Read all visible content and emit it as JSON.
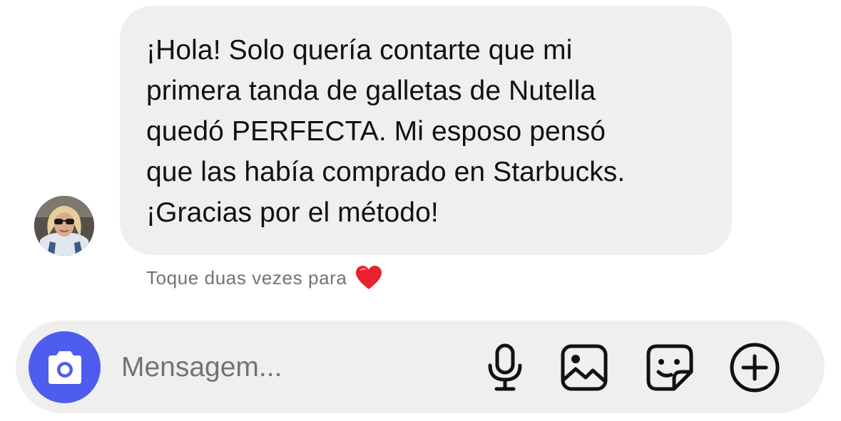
{
  "message": {
    "lines": [
      "¡Hola! Solo quería contarte que mi",
      "primera tanda de galletas de Nutella",
      "quedó PERFECTA. Mi esposo pensó",
      "que las había comprado en Starbucks.",
      "¡Gracias por el método!"
    ]
  },
  "reaction_hint": {
    "text": "Toque duas vezes para",
    "icon": "red-heart-icon"
  },
  "composer": {
    "placeholder": "Mensagem...",
    "value": "",
    "icons": [
      "camera-icon",
      "microphone-icon",
      "gallery-icon",
      "sticker-icon",
      "add-icon"
    ]
  },
  "colors": {
    "bubble": "#efefef",
    "camera_button": "#4f5cf0",
    "heart": "#e8232e",
    "hint_text": "#737373"
  }
}
